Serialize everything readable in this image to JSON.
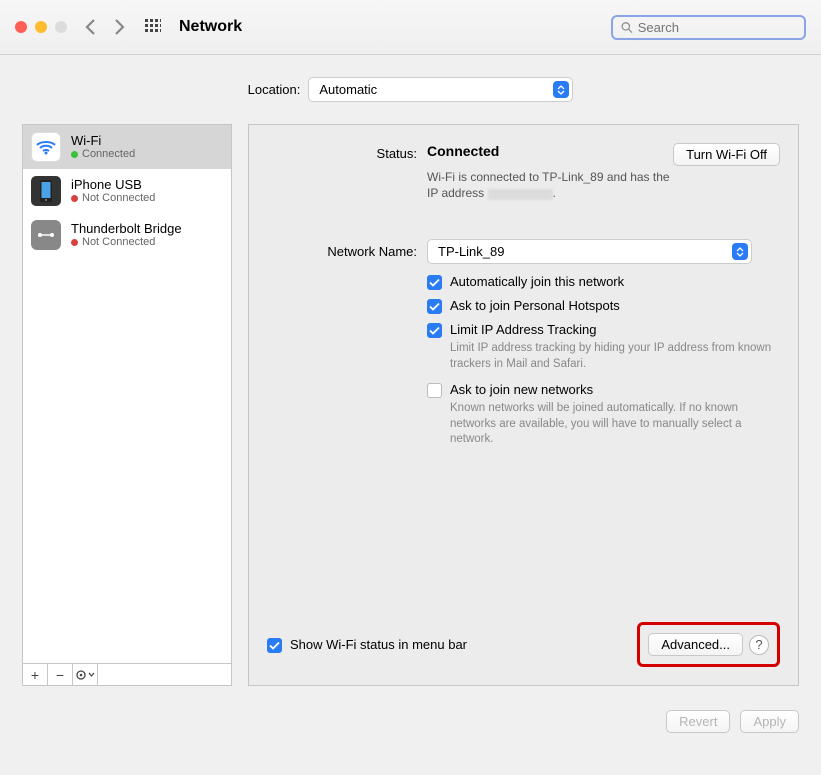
{
  "window": {
    "title": "Network"
  },
  "search": {
    "placeholder": "Search"
  },
  "location": {
    "label": "Location:",
    "value": "Automatic"
  },
  "sidebar": {
    "items": [
      {
        "name": "Wi-Fi",
        "status": "Connected",
        "connected": true
      },
      {
        "name": "iPhone USB",
        "status": "Not Connected",
        "connected": false
      },
      {
        "name": "Thunderbolt Bridge",
        "status": "Not Connected",
        "connected": false
      }
    ],
    "tools": {
      "add": "+",
      "remove": "−",
      "gear": "⚙︎"
    }
  },
  "main": {
    "status_label": "Status:",
    "status_value": "Connected",
    "turn_off": "Turn Wi-Fi Off",
    "status_desc1": "Wi-Fi is connected to TP-Link_89 and has the",
    "status_desc2": "IP address",
    "network_name_label": "Network Name:",
    "network_name_value": "TP-Link_89",
    "cb_auto_join": "Automatically join this network",
    "cb_ask_hotspot": "Ask to join Personal Hotspots",
    "cb_limit_ip": "Limit IP Address Tracking",
    "help_limit_ip": "Limit IP address tracking by hiding your IP address from known trackers in Mail and Safari.",
    "cb_ask_new": "Ask to join new networks",
    "help_ask_new": "Known networks will be joined automatically. If no known networks are available, you will have to manually select a network.",
    "show_menu_bar": "Show Wi-Fi status in menu bar",
    "advanced": "Advanced...",
    "help": "?"
  },
  "footer": {
    "revert": "Revert",
    "apply": "Apply"
  }
}
